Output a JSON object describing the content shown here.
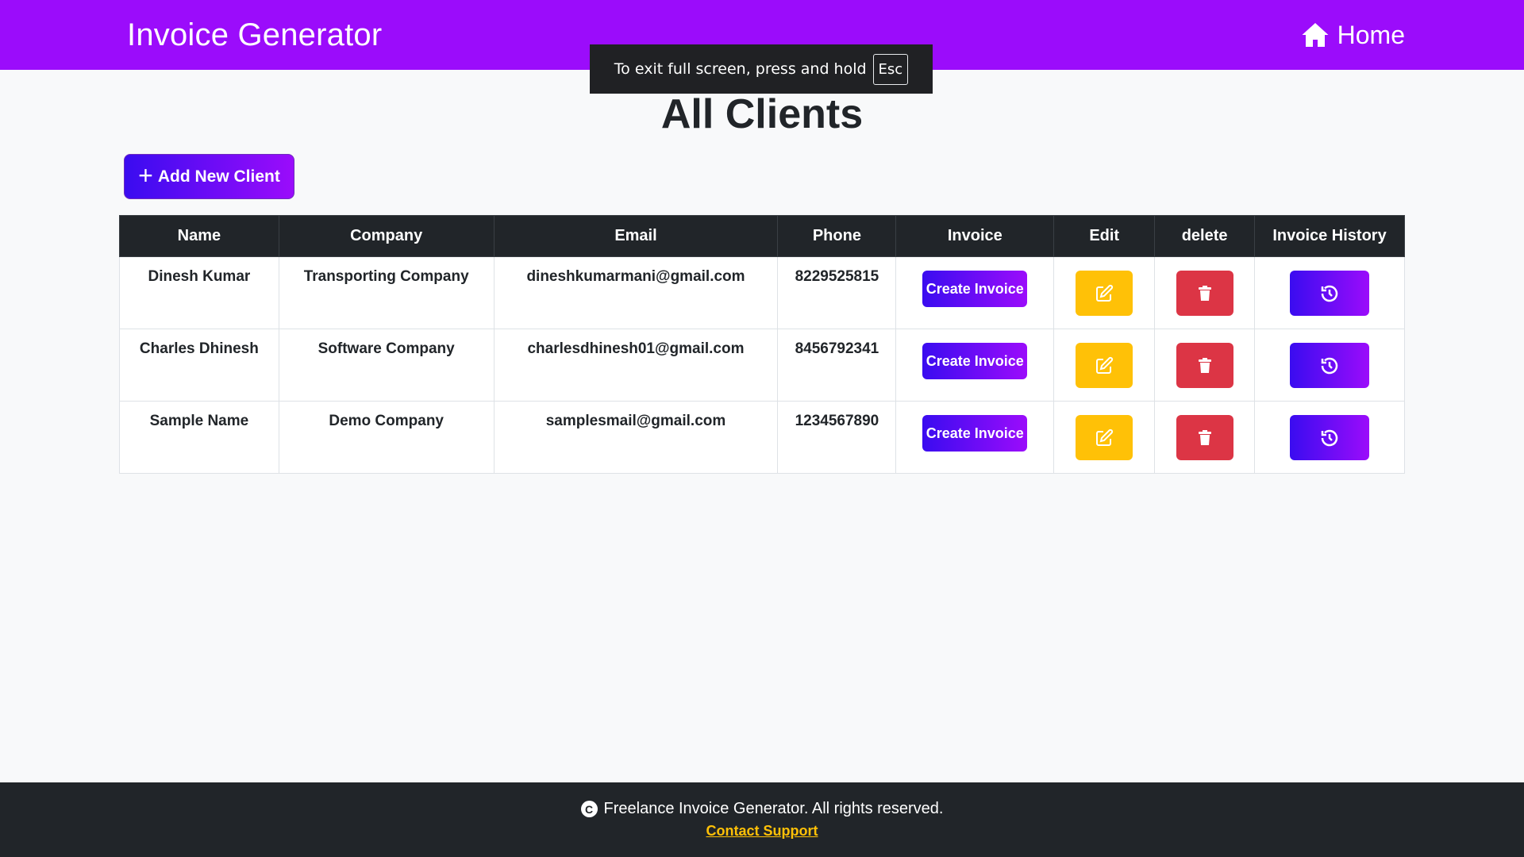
{
  "app": {
    "brand": "Invoice Generator",
    "home_label": "Home"
  },
  "fullscreen_notice": {
    "text": "To exit full screen, press and hold",
    "key": "Esc"
  },
  "page": {
    "title": "All Clients",
    "add_button": "Add New Client"
  },
  "table": {
    "headers": [
      "Name",
      "Company",
      "Email",
      "Phone",
      "Invoice",
      "Edit",
      "delete",
      "Invoice History"
    ],
    "rows": [
      {
        "name": "Dinesh Kumar",
        "company": "Transporting Company",
        "email": "dineshkumarmani@gmail.com",
        "phone": "8229525815",
        "invoice_label": "Create Invoice"
      },
      {
        "name": "Charles Dhinesh",
        "company": "Software Company",
        "email": "charlesdhinesh01@gmail.com",
        "phone": "8456792341",
        "invoice_label": "Create Invoice"
      },
      {
        "name": "Sample Name",
        "company": "Demo Company",
        "email": "samplesmail@gmail.com",
        "phone": "1234567890",
        "invoice_label": "Create Invoice"
      }
    ]
  },
  "footer": {
    "copyright": "Freelance Invoice Generator. All rights reserved.",
    "support_link": "Contact Support"
  },
  "colors": {
    "brand_purple": "#9b0cfb",
    "gradient_start": "#3a0cf0",
    "edit_yellow": "#ffc107",
    "delete_red": "#dc3545",
    "dark": "#212529"
  },
  "icons": {
    "home": "home-icon",
    "add": "plus-icon",
    "edit": "edit-icon",
    "delete": "trash-icon",
    "history": "history-icon",
    "copyright": "copyright-icon"
  }
}
